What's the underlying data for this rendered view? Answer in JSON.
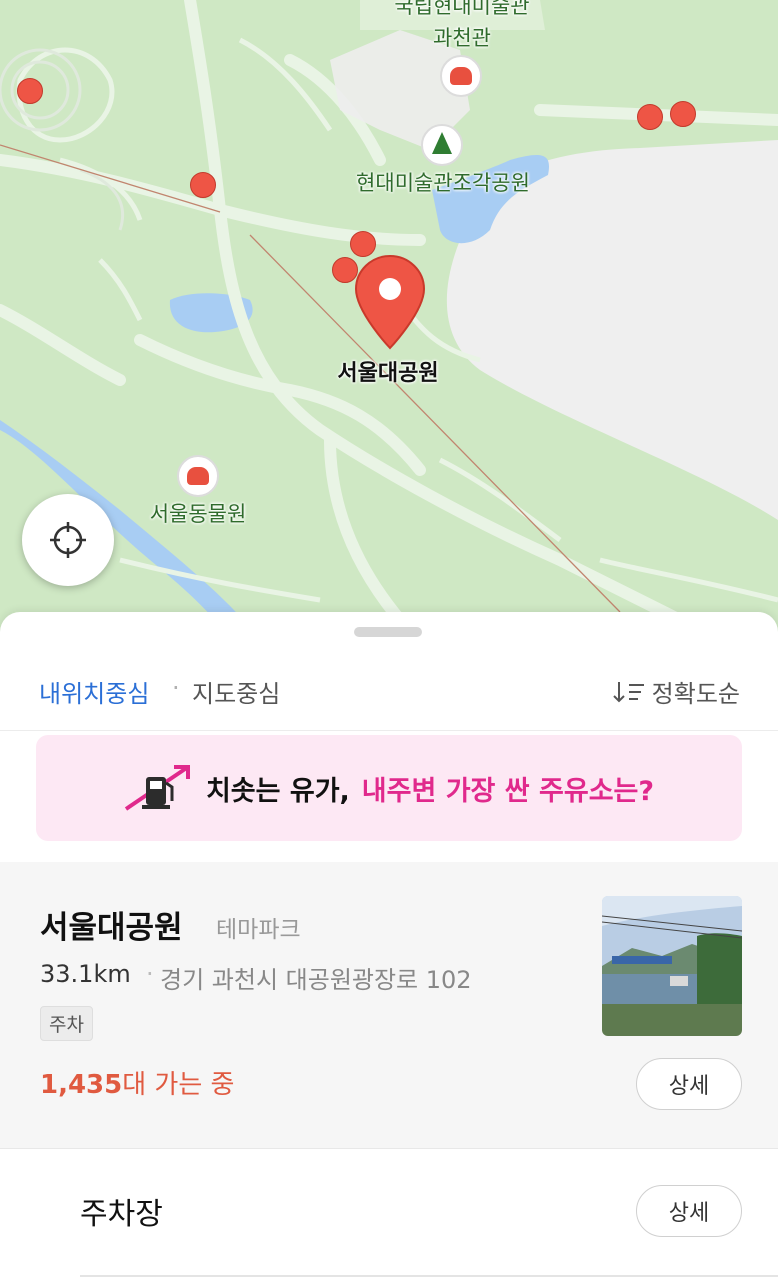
{
  "map": {
    "labels": {
      "museum_top": "국립현대미술관",
      "museum_sub": "과천관",
      "sculpture_park": "현대미술관조각공원",
      "main_place": "서울대공원",
      "zoo": "서울동물원"
    },
    "colors": {
      "land": "#cfe8c4",
      "road": "#e8f3e4",
      "water": "#a8cdf3",
      "pin": "#ee5545"
    },
    "locate_icon": "crosshair-icon"
  },
  "sheet": {
    "tabs": {
      "my_location": "내위치중심",
      "separator": "·",
      "map_center": "지도중심"
    },
    "sort_label": "정확도순",
    "sort_icon": "sort-desc-icon",
    "banner": {
      "icon": "fuel-price-icon",
      "text_black": "치솟는 유가,",
      "text_pink": "내주변 가장 싼 주유소는?"
    },
    "place": {
      "name": "서울대공원",
      "category": "테마파크",
      "distance": "33.1km",
      "separator": "·",
      "address": "경기 과천시 대공원광장로 102",
      "tag": "주차",
      "count_number": "1,435",
      "count_suffix": "대 가는 중",
      "detail_label": "상세"
    },
    "parking": {
      "label": "주차장",
      "detail_label": "상세"
    }
  }
}
